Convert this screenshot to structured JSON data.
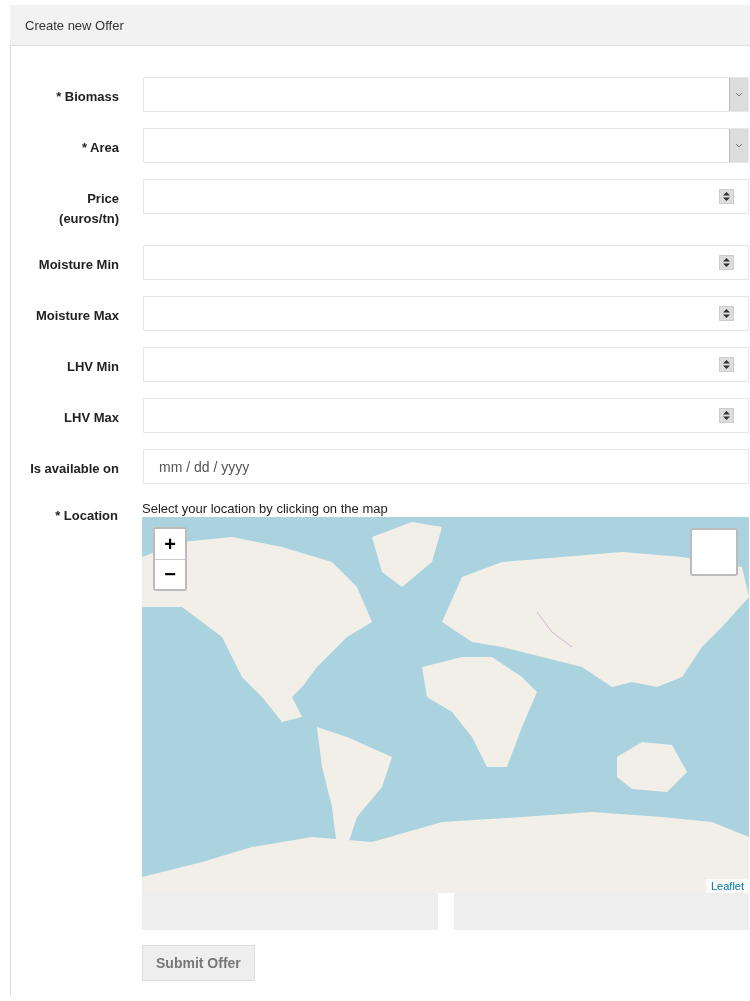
{
  "header": {
    "title": "Create new Offer"
  },
  "fields": [
    {
      "label": "* Biomass",
      "kind": "select"
    },
    {
      "label": "* Area",
      "kind": "select"
    },
    {
      "label": "Price (euros/tn)",
      "kind": "number"
    },
    {
      "label": "Moisture Min",
      "kind": "number"
    },
    {
      "label": "Moisture Max",
      "kind": "number"
    },
    {
      "label": "LHV Min",
      "kind": "number"
    },
    {
      "label": "LHV Max",
      "kind": "number"
    },
    {
      "label": "Is available on",
      "kind": "date",
      "placeholder": "mm / dd / yyyy"
    }
  ],
  "location": {
    "label": "* Location",
    "hint": "Select your location by clicking on the map",
    "zoom_in": "+",
    "zoom_out": "−",
    "attribution": "Leaflet"
  },
  "submit": {
    "label": "Submit Offer",
    "disabled": true
  }
}
